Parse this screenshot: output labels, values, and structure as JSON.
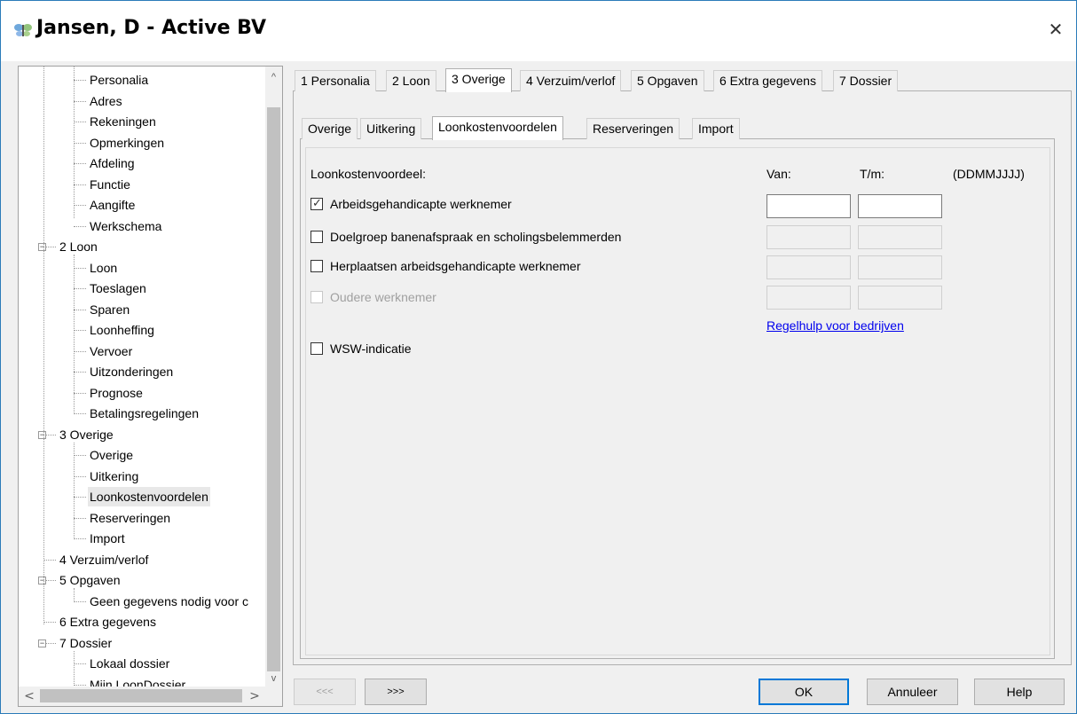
{
  "window": {
    "title": "Jansen, D - Active BV",
    "icon": "butterfly-app-icon",
    "close_glyph": "✕"
  },
  "tree": {
    "expander_collapse": "−",
    "items": [
      {
        "label": "Personalia",
        "level": 2
      },
      {
        "label": "Adres",
        "level": 2
      },
      {
        "label": "Rekeningen",
        "level": 2
      },
      {
        "label": "Opmerkingen",
        "level": 2
      },
      {
        "label": "Afdeling",
        "level": 2
      },
      {
        "label": "Functie",
        "level": 2
      },
      {
        "label": "Aangifte",
        "level": 2
      },
      {
        "label": "Werkschema",
        "level": 2
      },
      {
        "label": "2 Loon",
        "level": 1,
        "expanded": true
      },
      {
        "label": "Loon",
        "level": 2
      },
      {
        "label": "Toeslagen",
        "level": 2
      },
      {
        "label": "Sparen",
        "level": 2
      },
      {
        "label": "Loonheffing",
        "level": 2
      },
      {
        "label": "Vervoer",
        "level": 2
      },
      {
        "label": "Uitzonderingen",
        "level": 2
      },
      {
        "label": "Prognose",
        "level": 2
      },
      {
        "label": "Betalingsregelingen",
        "level": 2
      },
      {
        "label": "3 Overige",
        "level": 1,
        "expanded": true
      },
      {
        "label": "Overige",
        "level": 2
      },
      {
        "label": "Uitkering",
        "level": 2
      },
      {
        "label": "Loonkostenvoordelen",
        "level": 2,
        "selected": true
      },
      {
        "label": "Reserveringen",
        "level": 2
      },
      {
        "label": "Import",
        "level": 2
      },
      {
        "label": "4 Verzuim/verlof",
        "level": 1
      },
      {
        "label": "5 Opgaven",
        "level": 1,
        "expanded": true
      },
      {
        "label": "Geen gegevens nodig voor c",
        "level": 2
      },
      {
        "label": "6 Extra gegevens",
        "level": 1
      },
      {
        "label": "7 Dossier",
        "level": 1,
        "expanded": true
      },
      {
        "label": "Lokaal dossier",
        "level": 2
      },
      {
        "label": "Mijn LoonDossier",
        "level": 2
      }
    ],
    "scroll_up": "^",
    "scroll_down": "v",
    "scroll_left": "<",
    "scroll_right": ">"
  },
  "main_tabs": [
    {
      "label": "1 Personalia"
    },
    {
      "label": "2 Loon"
    },
    {
      "label": "3 Overige",
      "active": true
    },
    {
      "label": "4 Verzuim/verlof"
    },
    {
      "label": "5 Opgaven"
    },
    {
      "label": "6 Extra gegevens"
    },
    {
      "label": "7 Dossier"
    }
  ],
  "sub_tabs": [
    {
      "label": "Overige"
    },
    {
      "label": "Uitkering"
    },
    {
      "label": "Loonkostenvoordelen",
      "active": true
    },
    {
      "label": "Reserveringen"
    },
    {
      "label": "Import"
    }
  ],
  "form": {
    "heading": "Loonkostenvoordeel:",
    "col_van": "Van:",
    "col_tm": "T/m:",
    "date_format": "(DDMMJJJJ)",
    "rows": [
      {
        "label": "Arbeidsgehandicapte werknemer",
        "checked": true,
        "enabled": true,
        "van": "",
        "tm": ""
      },
      {
        "label": "Doelgroep banenafspraak en scholingsbelemmerden",
        "checked": false,
        "enabled": true,
        "van": "",
        "tm": ""
      },
      {
        "label": "Herplaatsen arbeidsgehandicapte werknemer",
        "checked": false,
        "enabled": true,
        "van": "",
        "tm": ""
      },
      {
        "label": "Oudere werknemer",
        "checked": false,
        "enabled": false,
        "van": "",
        "tm": ""
      }
    ],
    "check_glyph": "✓",
    "link": "Regelhulp voor bedrijven",
    "wsw_label": "WSW-indicatie",
    "wsw_checked": false
  },
  "buttons": {
    "prev": "<<<",
    "next": ">>>",
    "ok": "OK",
    "cancel": "Annuleer",
    "help": "Help"
  }
}
